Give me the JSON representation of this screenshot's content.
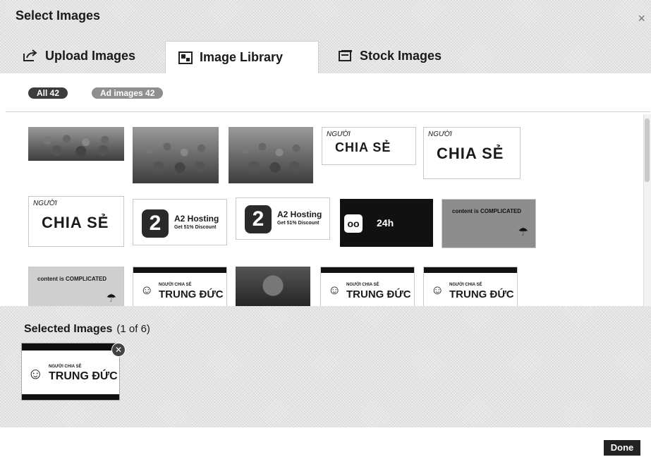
{
  "dialog": {
    "title": "Select Images",
    "close_glyph": "×"
  },
  "tabs": [
    {
      "label": "Upload Images",
      "icon": "upload-icon",
      "active": false
    },
    {
      "label": "Image Library",
      "icon": "library-icon",
      "active": true
    },
    {
      "label": "Stock Images",
      "icon": "stock-icon",
      "active": false
    }
  ],
  "filters": {
    "all_label": "All 42",
    "ad_label": "Ad images 42"
  },
  "gallery": {
    "chiase_small": "NGƯỜI",
    "chiase_big": "CHIA SẺ",
    "a2_title": "A2 Hosting",
    "a2_sub": "Get 51% Discount",
    "twenty4_text": "24h",
    "complicated_text": "content is COMPLICATED",
    "trung_small": "NGƯỜI CHIA SẺ",
    "trung_big": "TRUNG ĐỨC"
  },
  "selected": {
    "title": "Selected Images",
    "count": "(1 of 6)",
    "thumb_small": "NGƯỜI CHIA SẺ",
    "thumb_big": "TRUNG ĐỨC",
    "remove_glyph": "✕"
  },
  "footer": {
    "done_label": "Done"
  },
  "colors": {
    "active_pill": "#3d3d3d",
    "inactive_pill": "#8f8f8f",
    "done_button": "#222222"
  }
}
